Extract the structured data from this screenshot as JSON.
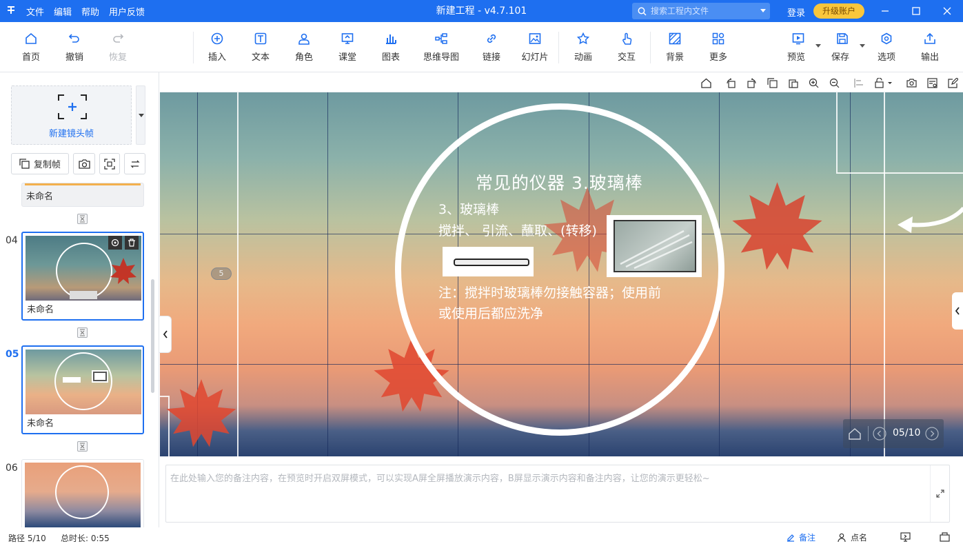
{
  "app": {
    "menu": [
      "文件",
      "编辑",
      "帮助",
      "用户反馈"
    ],
    "title": "新建工程 - v4.7.101",
    "search_placeholder": "搜索工程内文件",
    "login": "登录",
    "upgrade": "升级账户",
    "brand_color": "#1e6ff0"
  },
  "toolbar": {
    "home": "首页",
    "undo": "撤销",
    "redo": "恢复",
    "insert": "插入",
    "text": "文本",
    "role": "角色",
    "classroom": "课堂",
    "chart": "图表",
    "mindmap": "思维导图",
    "link": "链接",
    "slideshow": "幻灯片",
    "animation": "动画",
    "interact": "交互",
    "background": "背景",
    "more": "更多",
    "preview": "预览",
    "save": "保存",
    "options": "选项",
    "export": "输出"
  },
  "sidebar": {
    "new_frame": "新建镜头帧",
    "copy_frame": "复制帧",
    "slides": [
      {
        "num": "",
        "name": "未命名"
      },
      {
        "num": "04",
        "name": "未命名"
      },
      {
        "num": "05",
        "name": "未命名"
      },
      {
        "num": "06",
        "name": ""
      }
    ]
  },
  "slide": {
    "title": "常见的仪器 3.玻璃棒",
    "line1": "3、玻璃棒",
    "line2": "搅拌、 引流、蘸取、(转移)",
    "note_line1": "注：搅拌时玻璃棒勿接触容器；使用前",
    "note_line2": "或使用后都应洗净",
    "path_badge": "5",
    "page_indicator": "05/10"
  },
  "notes": {
    "placeholder": "在此处输入您的备注内容，在预览时开启双屏模式，可以实现A屏全屏播放演示内容，B屏显示演示内容和备注内容，让您的演示更轻松~"
  },
  "status": {
    "path": "路径 5/10",
    "duration": "总时长: 0:55",
    "notes_btn": "备注",
    "rollcall": "点名"
  }
}
